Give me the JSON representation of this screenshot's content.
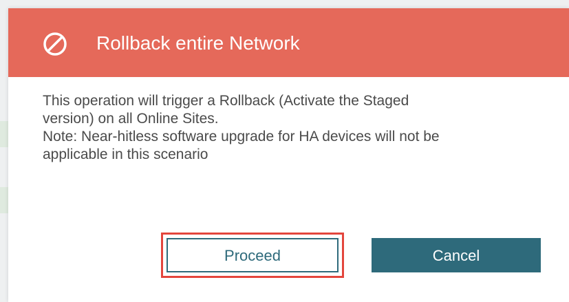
{
  "dialog": {
    "title": "Rollback entire Network",
    "icon": "prohibited-icon",
    "body_lines": [
      "This operation will trigger a Rollback (Activate the Staged",
      "version) on all Online Sites.",
      "Note: Near-hitless software upgrade for HA devices will not be",
      "applicable in this scenario"
    ],
    "proceed_label": "Proceed",
    "cancel_label": "Cancel"
  },
  "colors": {
    "header": "#e5695a",
    "accent": "#2e6a7b",
    "focus_outline": "#e3453c",
    "body_text": "#4a4a4a"
  }
}
